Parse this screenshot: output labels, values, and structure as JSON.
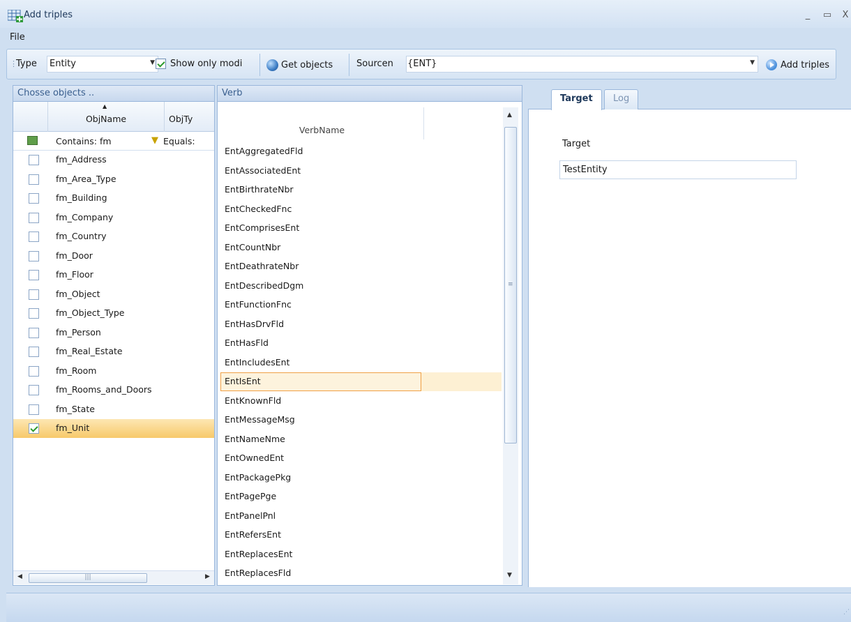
{
  "window": {
    "title": "Add triples",
    "minimize": "_",
    "maximize": "▭",
    "close": "X"
  },
  "menu": {
    "file": "File"
  },
  "toolbar": {
    "type_label": "Type",
    "type_value": "Entity",
    "show_only_label": "Show only modi",
    "show_only_checked": true,
    "get_objects": "Get objects",
    "source_label": "Sourcen",
    "source_value": "{ENT}",
    "add_triples": "Add triples"
  },
  "objects_panel": {
    "header": "Chosse objects ..",
    "columns": [
      "ObjName",
      "ObjTy"
    ],
    "filter": {
      "contains": "Contains: fm",
      "equals": "Equals:"
    },
    "items": [
      {
        "name": "fm_Address",
        "checked": false
      },
      {
        "name": "fm_Area_Type",
        "checked": false
      },
      {
        "name": "fm_Building",
        "checked": false
      },
      {
        "name": "fm_Company",
        "checked": false
      },
      {
        "name": "fm_Country",
        "checked": false
      },
      {
        "name": "fm_Door",
        "checked": false
      },
      {
        "name": "fm_Floor",
        "checked": false
      },
      {
        "name": "fm_Object",
        "checked": false
      },
      {
        "name": "fm_Object_Type",
        "checked": false
      },
      {
        "name": "fm_Person",
        "checked": false
      },
      {
        "name": "fm_Real_Estate",
        "checked": false
      },
      {
        "name": "fm_Room",
        "checked": false
      },
      {
        "name": "fm_Rooms_and_Doors",
        "checked": false
      },
      {
        "name": "fm_State",
        "checked": false
      },
      {
        "name": "fm_Unit",
        "checked": true
      }
    ],
    "selected_index": 14
  },
  "verb_panel": {
    "header": "Verb",
    "column": "VerbName",
    "items": [
      "EntAggregatedFld",
      "EntAssociatedEnt",
      "EntBirthrateNbr",
      "EntCheckedFnc",
      "EntComprisesEnt",
      "EntCountNbr",
      "EntDeathrateNbr",
      "EntDescribedDgm",
      "EntFunctionFnc",
      "EntHasDrvFld",
      "EntHasFld",
      "EntIncludesEnt",
      "EntIsEnt",
      "EntKnownFld",
      "EntMessageMsg",
      "EntNameNme",
      "EntOwnedEnt",
      "EntPackagePkg",
      "EntPagePge",
      "EntPanelPnl",
      "EntRefersEnt",
      "EntReplacesEnt",
      "EntReplacesFld"
    ],
    "selected_index": 12
  },
  "tabs": [
    {
      "label": "Target",
      "active": true
    },
    {
      "label": "Log",
      "active": false
    }
  ],
  "target": {
    "label": "Target",
    "value": "TestEntity"
  },
  "scrollbar": {
    "grip": "|||",
    "vgrip": "≡"
  }
}
